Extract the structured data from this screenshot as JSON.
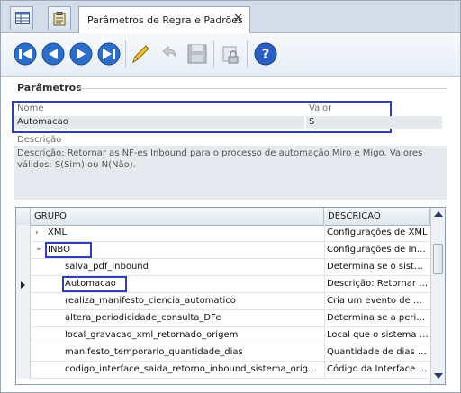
{
  "window": {
    "tab_title": "Parâmetros de Regra e Padrões",
    "tab_close": "✕"
  },
  "toolbar": {
    "buttons": [
      "first-record",
      "previous-record",
      "next-record",
      "last-record",
      "edit",
      "undo",
      "save",
      "lock",
      "help"
    ],
    "help_glyph": "?"
  },
  "params": {
    "section_title": "Parâmetros",
    "name_label": "Nome",
    "value_label": "Valor",
    "name_value": "Automacao",
    "value_value": "S",
    "desc_label": "Descrição",
    "desc_text": "Descrição: Retornar as NF-es Inbound para o processo de automação Miro e Migo. Valores válidos: S(Sim) ou N(Não)."
  },
  "grid": {
    "columns": [
      "GRUPO",
      "DESCRICAO"
    ],
    "rows": [
      {
        "grupo": "XML",
        "descricao": "Configurações de XML",
        "chevron": "›"
      },
      {
        "grupo": "INBO",
        "descricao": "Configurações de Inbound",
        "chevron": "⌄"
      },
      {
        "grupo": "salva_pdf_inbound",
        "descricao": "Determina se o sistema salva o PDF"
      },
      {
        "grupo": "Automacao",
        "descricao": "Descrição: Retornar as NF-es Inbound"
      },
      {
        "grupo": "realiza_manifesto_ciencia_automatico",
        "descricao": "Cria um evento de manifesto"
      },
      {
        "grupo": "altera_periodicidade_consulta_DFe",
        "descricao": "Determina se a periodicidade"
      },
      {
        "grupo": "local_gravacao_xml_retornado_origem",
        "descricao": "Local que o sistema grava"
      },
      {
        "grupo": "manifesto_temporario_quantidade_dias",
        "descricao": "Quantidade de dias do manifesto"
      },
      {
        "grupo": "codigo_interface_saida_retorno_inbound_sistema_origem",
        "descricao": "Código da Interface de saída"
      }
    ]
  },
  "colors": {
    "highlight": "#2f3fb4",
    "tab_bar": "#d3dde9",
    "field_bg": "#e6e9ed"
  }
}
